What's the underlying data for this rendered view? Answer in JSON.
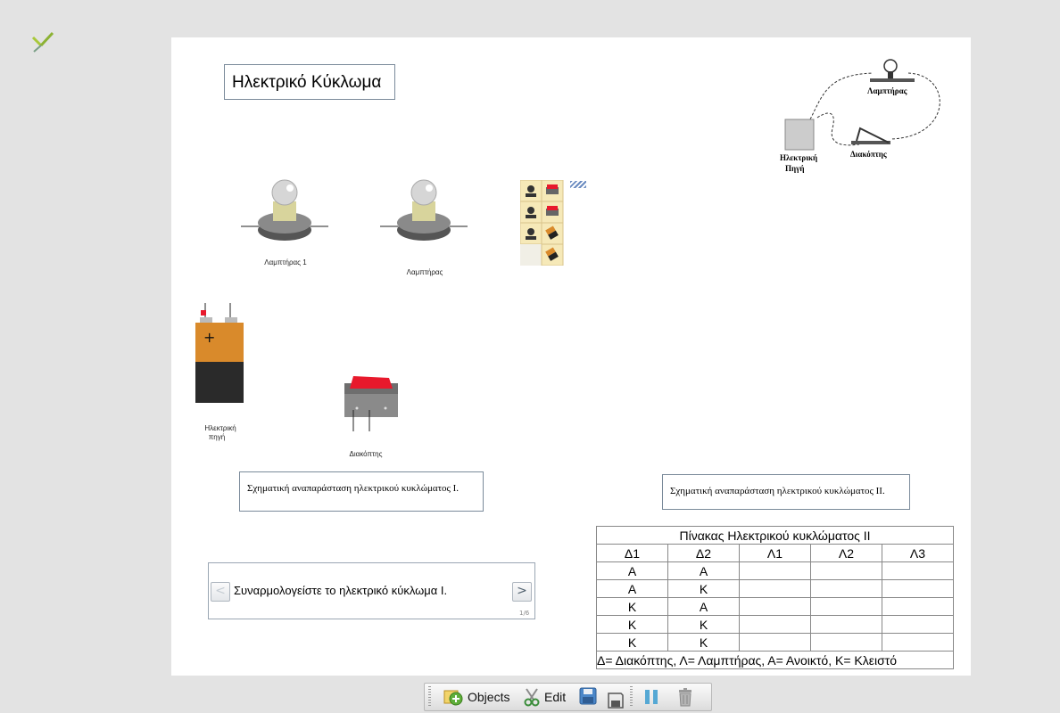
{
  "canvas": {
    "title": "Ηλεκτρικό Κύκλωμα",
    "components": {
      "lamp1_label": "Λαμπτήρας 1",
      "lamp2_label": "Λαμπτήρας",
      "source_label_line1": "Ηλεκτρική",
      "source_label_line2": "πηγή",
      "switch_label": "Διακόπτης"
    },
    "diagram": {
      "lamp_label": "Λαμπτήρας",
      "switch_label": "Διακόπτης",
      "source_label_line1": "Ηλεκτρική",
      "source_label_line2": "Πηγή"
    },
    "schematic_1": "Σχηματική αναπαράσταση ηλεκτρικού κυκλώματος Ι.",
    "schematic_2": "Σχηματική αναπαράσταση ηλεκτρικού κυκλώματος ΙΙ.",
    "steps": {
      "text": "Συναρμολογείστε το ηλεκτρικό κύκλωμα Ι.",
      "counter": "1/6",
      "prev": "<",
      "next": ">"
    },
    "table": {
      "title": "Πίνακας Ηλεκτρικού κυκλώματος ΙΙ",
      "headers": [
        "Δ1",
        "Δ2",
        "Λ1",
        "Λ2",
        "Λ3"
      ],
      "rows": [
        [
          "Α",
          "Α",
          "",
          "",
          ""
        ],
        [
          "Α",
          "Κ",
          "",
          "",
          ""
        ],
        [
          "Κ",
          "Α",
          "",
          "",
          ""
        ],
        [
          "Κ",
          "Κ",
          "",
          "",
          ""
        ],
        [
          "Κ",
          "Κ",
          "",
          "",
          ""
        ]
      ],
      "legend": "Δ= Διακόπτης, Λ= Λαμπτήρας, Α= Ανοικτό, Κ= Κλειστό"
    }
  },
  "toolbar": {
    "objects_label": "Objects",
    "edit_label": "Edit"
  },
  "colors": {
    "accent_green": "#7ab03a",
    "switch_red": "#e8192c",
    "battery_orange": "#d98a2b",
    "toolbar_blue": "#4a86c8"
  }
}
